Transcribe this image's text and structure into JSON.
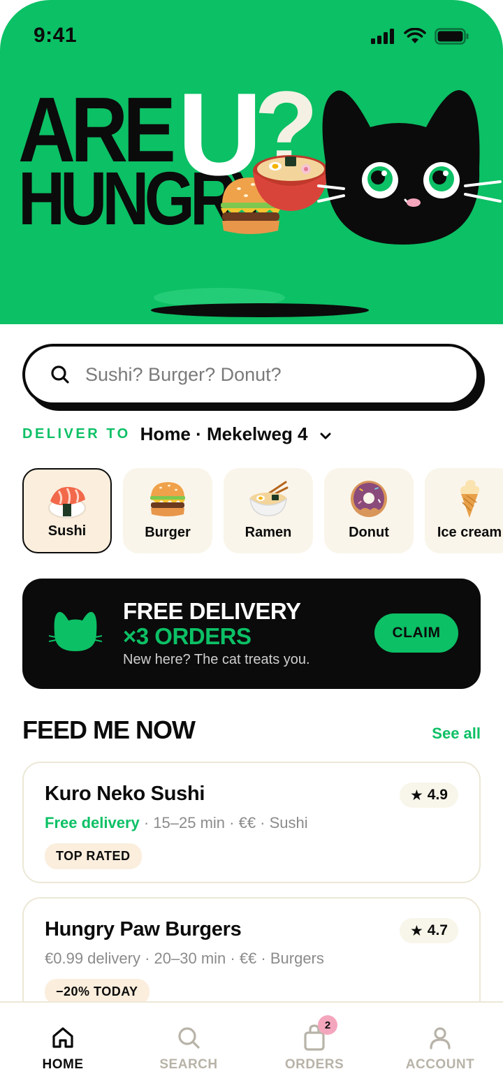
{
  "status_bar": {
    "time": "9:41"
  },
  "hero": {
    "line1": "ARE",
    "letter_u": "U",
    "question": "?",
    "line2": "HUNGRY"
  },
  "search": {
    "placeholder": "Sushi? Burger? Donut?",
    "value": ""
  },
  "delivery": {
    "label": "DELIVER TO",
    "address": "Home · Mekelweg 4"
  },
  "categories": [
    {
      "label": "Sushi",
      "icon": "sushi-icon",
      "selected": true
    },
    {
      "label": "Burger",
      "icon": "burger-icon",
      "selected": false
    },
    {
      "label": "Ramen",
      "icon": "ramen-icon",
      "selected": false
    },
    {
      "label": "Donut",
      "icon": "donut-icon",
      "selected": false
    },
    {
      "label": "Ice cream",
      "icon": "ice-cream-icon",
      "selected": false
    }
  ],
  "promo": {
    "title_line1": "FREE DELIVERY",
    "title_line2": "×3 ORDERS",
    "subtitle": "New here? The cat treats you.",
    "cta": "CLAIM"
  },
  "feed": {
    "title": "FEED ME NOW",
    "see_all": "See all",
    "restaurants": [
      {
        "name": "Kuro Neko Sushi",
        "rating": "4.9",
        "delivery": "Free delivery",
        "details": " · 15–25 min · €€ · Sushi",
        "tag": "TOP RATED"
      },
      {
        "name": "Hungry Paw Burgers",
        "rating": "4.7",
        "delivery": "€0.99 delivery",
        "details": " · 20–30 min · €€ · Burgers",
        "tag": "−20% TODAY"
      }
    ]
  },
  "tabs": [
    {
      "label": "HOME",
      "icon": "home-icon",
      "active": true
    },
    {
      "label": "SEARCH",
      "icon": "search-icon",
      "active": false
    },
    {
      "label": "ORDERS",
      "icon": "shopping-bag-icon",
      "active": false,
      "badge": "2"
    },
    {
      "label": "ACCOUNT",
      "icon": "user-icon",
      "active": false
    }
  ],
  "colors": {
    "brand_green": "#0cc065",
    "ink": "#0b0b0b",
    "cream": "#faf5ea",
    "badge_pink": "#f4a6bd"
  }
}
